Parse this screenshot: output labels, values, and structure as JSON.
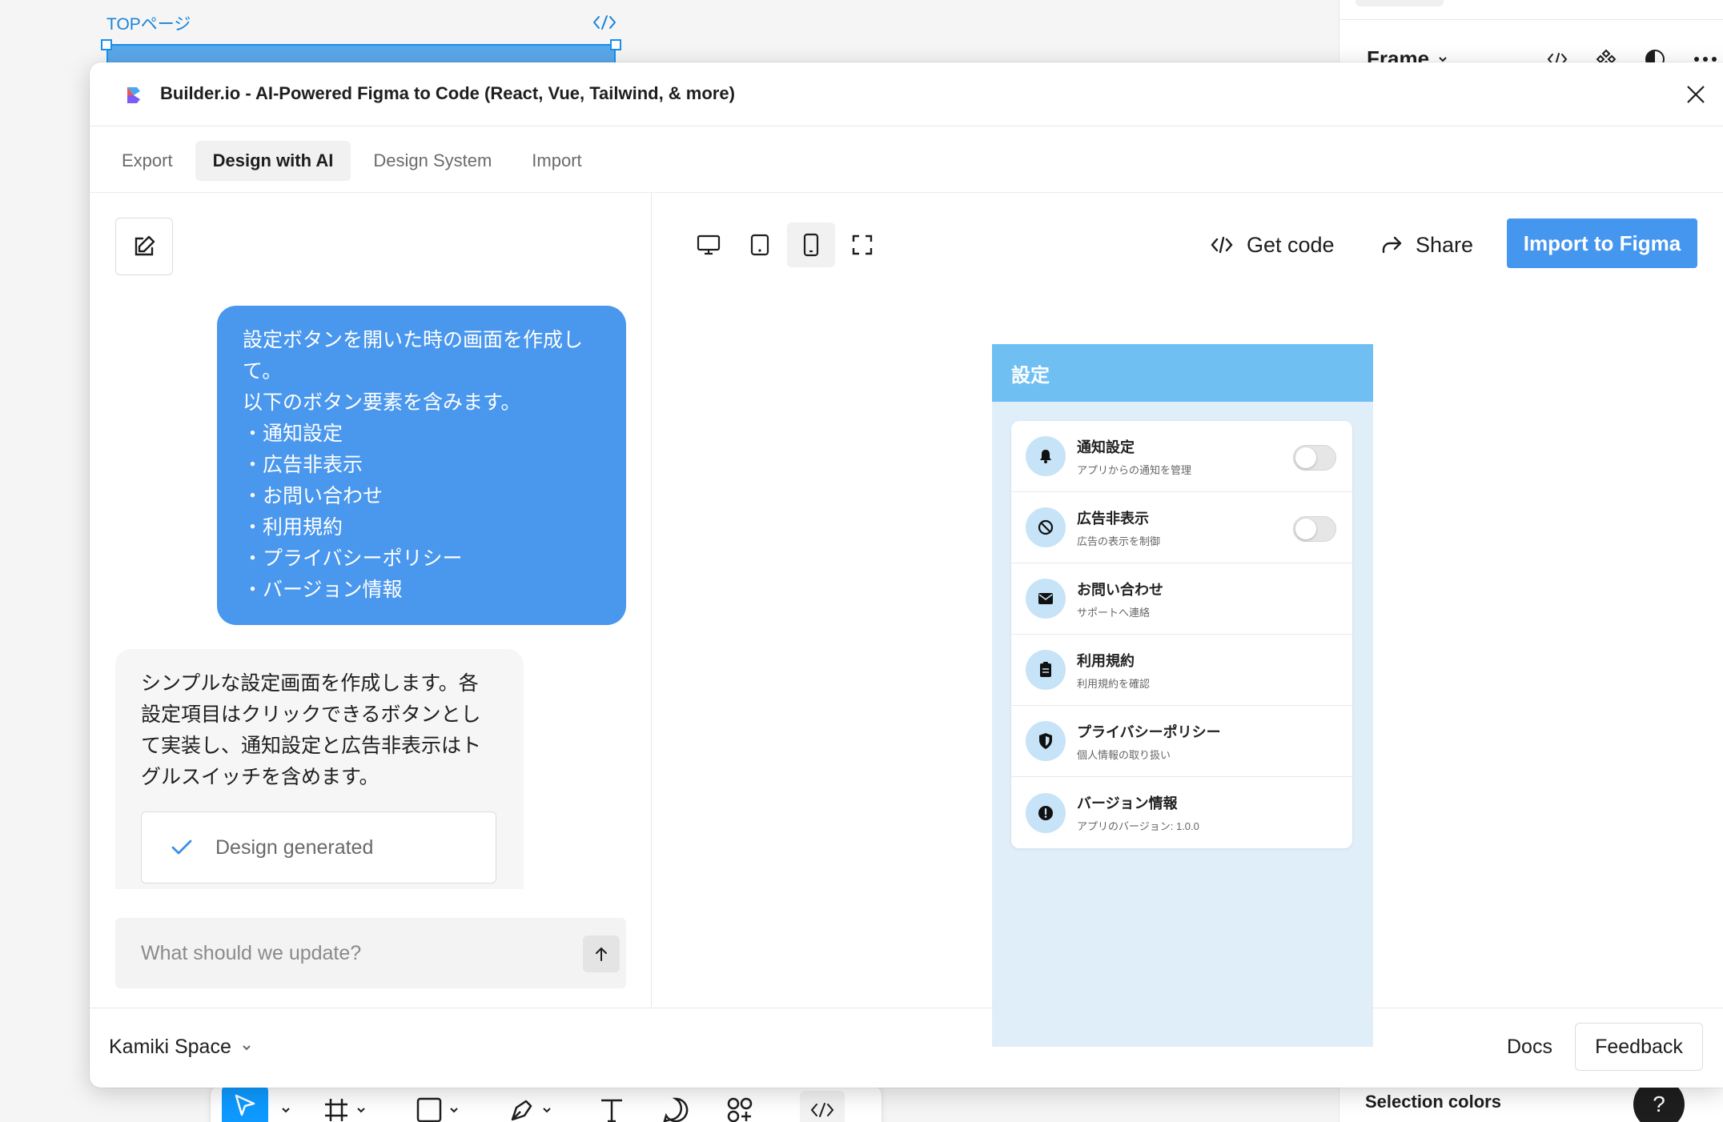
{
  "canvas": {
    "frame_label": "TOPページ"
  },
  "right_panel": {
    "frame_title": "Frame",
    "selection_colors": "Selection colors",
    "help": "?"
  },
  "modal": {
    "title": "Builder.io - AI-Powered Figma to Code (React, Vue, Tailwind, & more)",
    "tabs": [
      {
        "label": "Export"
      },
      {
        "label": "Design with AI"
      },
      {
        "label": "Design System"
      },
      {
        "label": "Import"
      }
    ],
    "chat": {
      "user_message": "設定ボタンを開いた時の画面を作成して。\n以下のボタン要素を含みます。\n・通知設定\n・広告非表示\n・お問い合わせ\n・利用規約\n・プライバシーポリシー\n・バージョン情報",
      "ai_message": "シンプルな設定画面を作成します。各設定項目はクリックできるボタンとして実装し、通知設定と広告非表示はトグルスイッチを含めます。",
      "design_status": "Design generated",
      "prompt_placeholder": "What should we update?"
    },
    "preview": {
      "get_code": "Get code",
      "share": "Share",
      "import": "Import to Figma",
      "mobile": {
        "header": "設定",
        "items": [
          {
            "title": "通知設定",
            "subtitle": "アプリからの通知を管理",
            "icon": "bell-icon"
          },
          {
            "title": "広告非表示",
            "subtitle": "広告の表示を制御",
            "icon": "block-icon"
          },
          {
            "title": "お問い合わせ",
            "subtitle": "サポートへ連絡",
            "icon": "mail-icon"
          },
          {
            "title": "利用規約",
            "subtitle": "利用規約を確認",
            "icon": "document-icon"
          },
          {
            "title": "プライバシーポリシー",
            "subtitle": "個人情報の取り扱い",
            "icon": "shield-icon"
          },
          {
            "title": "バージョン情報",
            "subtitle": "アプリのバージョン: 1.0.0",
            "icon": "info-icon"
          }
        ]
      }
    },
    "footer": {
      "workspace": "Kamiki Space",
      "docs": "Docs",
      "feedback": "Feedback"
    }
  },
  "colors": {
    "accent": "#4596ef",
    "user_bubble": "#4a97ee",
    "mobile_header": "#6fbff3",
    "mobile_bg": "#e0eef9"
  }
}
